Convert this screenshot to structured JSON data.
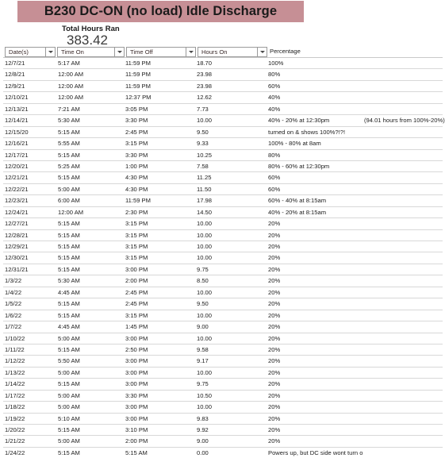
{
  "title": "B230 DC-ON (no load) Idle Discharge",
  "summary": {
    "label": "Total Hours Ran",
    "value": "383.42"
  },
  "colors": {
    "title_banner": "#c68f95",
    "grid_line": "#d8d8d8",
    "header_border": "#9a9a9a"
  },
  "table": {
    "columns": [
      {
        "label": "Date(s)",
        "filter": true
      },
      {
        "label": "Time On",
        "filter": true
      },
      {
        "label": "Time Off",
        "filter": true
      },
      {
        "label": "Hours On",
        "filter": true
      },
      {
        "label": "Percentage",
        "filter": false
      }
    ],
    "rows": [
      {
        "date": "12/7/21",
        "on": "5:17 AM",
        "off": "11:59 PM",
        "hours": "18.70",
        "pct": "100%",
        "note": ""
      },
      {
        "date": "12/8/21",
        "on": "12:00 AM",
        "off": "11:59 PM",
        "hours": "23.98",
        "pct": "80%",
        "note": ""
      },
      {
        "date": "12/9/21",
        "on": "12:00 AM",
        "off": "11:59 PM",
        "hours": "23.98",
        "pct": "60%",
        "note": ""
      },
      {
        "date": "12/10/21",
        "on": "12:00 AM",
        "off": "12:37 PM",
        "hours": "12.62",
        "pct": "40%",
        "note": ""
      },
      {
        "date": "12/13/21",
        "on": "7:21 AM",
        "off": "3:05 PM",
        "hours": "7.73",
        "pct": "40%",
        "note": ""
      },
      {
        "date": "12/14/21",
        "on": "5:30 AM",
        "off": "3:30 PM",
        "hours": "10.00",
        "pct": "40% - 20% at 12:30pm",
        "note": "(94.01 hours from 100%-20%)"
      },
      {
        "date": "12/15/20",
        "on": "5:15 AM",
        "off": "2:45 PM",
        "hours": "9.50",
        "pct": "turned on & shows 100%?!?!",
        "note": ""
      },
      {
        "date": "12/16/21",
        "on": "5:55 AM",
        "off": "3:15 PM",
        "hours": "9.33",
        "pct": "100% - 80% at 8am",
        "note": ""
      },
      {
        "date": "12/17/21",
        "on": "5:15 AM",
        "off": "3:30 PM",
        "hours": "10.25",
        "pct": "80%",
        "note": ""
      },
      {
        "date": "12/20/21",
        "on": "5:25 AM",
        "off": "1:00 PM",
        "hours": "7.58",
        "pct": "80% - 60% at 12:30pm",
        "note": ""
      },
      {
        "date": "12/21/21",
        "on": "5:15 AM",
        "off": "4:30 PM",
        "hours": "11.25",
        "pct": "60%",
        "note": ""
      },
      {
        "date": "12/22/21",
        "on": "5:00 AM",
        "off": "4:30 PM",
        "hours": "11.50",
        "pct": "60%",
        "note": ""
      },
      {
        "date": "12/23/21",
        "on": "6:00 AM",
        "off": "11:59 PM",
        "hours": "17.98",
        "pct": "60% - 40% at 8:15am",
        "note": ""
      },
      {
        "date": "12/24/21",
        "on": "12:00 AM",
        "off": "2:30 PM",
        "hours": "14.50",
        "pct": "40% - 20% at 8:15am",
        "note": ""
      },
      {
        "date": "12/27/21",
        "on": "5:15 AM",
        "off": "3:15 PM",
        "hours": "10.00",
        "pct": "20%",
        "note": ""
      },
      {
        "date": "12/28/21",
        "on": "5:15 AM",
        "off": "3:15 PM",
        "hours": "10.00",
        "pct": "20%",
        "note": ""
      },
      {
        "date": "12/29/21",
        "on": "5:15 AM",
        "off": "3:15 PM",
        "hours": "10.00",
        "pct": "20%",
        "note": ""
      },
      {
        "date": "12/30/21",
        "on": "5:15 AM",
        "off": "3:15 PM",
        "hours": "10.00",
        "pct": "20%",
        "note": ""
      },
      {
        "date": "12/31/21",
        "on": "5:15 AM",
        "off": "3:00 PM",
        "hours": "9.75",
        "pct": "20%",
        "note": ""
      },
      {
        "date": "1/3/22",
        "on": "5:30 AM",
        "off": "2:00 PM",
        "hours": "8.50",
        "pct": "20%",
        "note": ""
      },
      {
        "date": "1/4/22",
        "on": "4:45 AM",
        "off": "2:45 PM",
        "hours": "10.00",
        "pct": "20%",
        "note": ""
      },
      {
        "date": "1/5/22",
        "on": "5:15 AM",
        "off": "2:45 PM",
        "hours": "9.50",
        "pct": "20%",
        "note": ""
      },
      {
        "date": "1/6/22",
        "on": "5:15 AM",
        "off": "3:15 PM",
        "hours": "10.00",
        "pct": "20%",
        "note": ""
      },
      {
        "date": "1/7/22",
        "on": "4:45 AM",
        "off": "1:45 PM",
        "hours": "9.00",
        "pct": "20%",
        "note": ""
      },
      {
        "date": "1/10/22",
        "on": "5:00 AM",
        "off": "3:00 PM",
        "hours": "10.00",
        "pct": "20%",
        "note": ""
      },
      {
        "date": "1/11/22",
        "on": "5:15 AM",
        "off": "2:50 PM",
        "hours": "9.58",
        "pct": "20%",
        "note": ""
      },
      {
        "date": "1/12/22",
        "on": "5:50 AM",
        "off": "3:00 PM",
        "hours": "9.17",
        "pct": "20%",
        "note": ""
      },
      {
        "date": "1/13/22",
        "on": "5:00 AM",
        "off": "3:00 PM",
        "hours": "10.00",
        "pct": "20%",
        "note": ""
      },
      {
        "date": "1/14/22",
        "on": "5:15 AM",
        "off": "3:00 PM",
        "hours": "9.75",
        "pct": "20%",
        "note": ""
      },
      {
        "date": "1/17/22",
        "on": "5:00 AM",
        "off": "3:30 PM",
        "hours": "10.50",
        "pct": "20%",
        "note": ""
      },
      {
        "date": "1/18/22",
        "on": "5:00 AM",
        "off": "3:00 PM",
        "hours": "10.00",
        "pct": "20%",
        "note": ""
      },
      {
        "date": "1/19/22",
        "on": "5:10 AM",
        "off": "3:00 PM",
        "hours": "9.83",
        "pct": "20%",
        "note": ""
      },
      {
        "date": "1/20/22",
        "on": "5:15 AM",
        "off": "3:10 PM",
        "hours": "9.92",
        "pct": "20%",
        "note": ""
      },
      {
        "date": "1/21/22",
        "on": "5:00 AM",
        "off": "2:00 PM",
        "hours": "9.00",
        "pct": "20%",
        "note": ""
      },
      {
        "date": "1/24/22",
        "on": "5:15 AM",
        "off": "5:15 AM",
        "hours": "0.00",
        "pct": "Powers up, but DC side wont turn on.",
        "note": ""
      }
    ]
  }
}
